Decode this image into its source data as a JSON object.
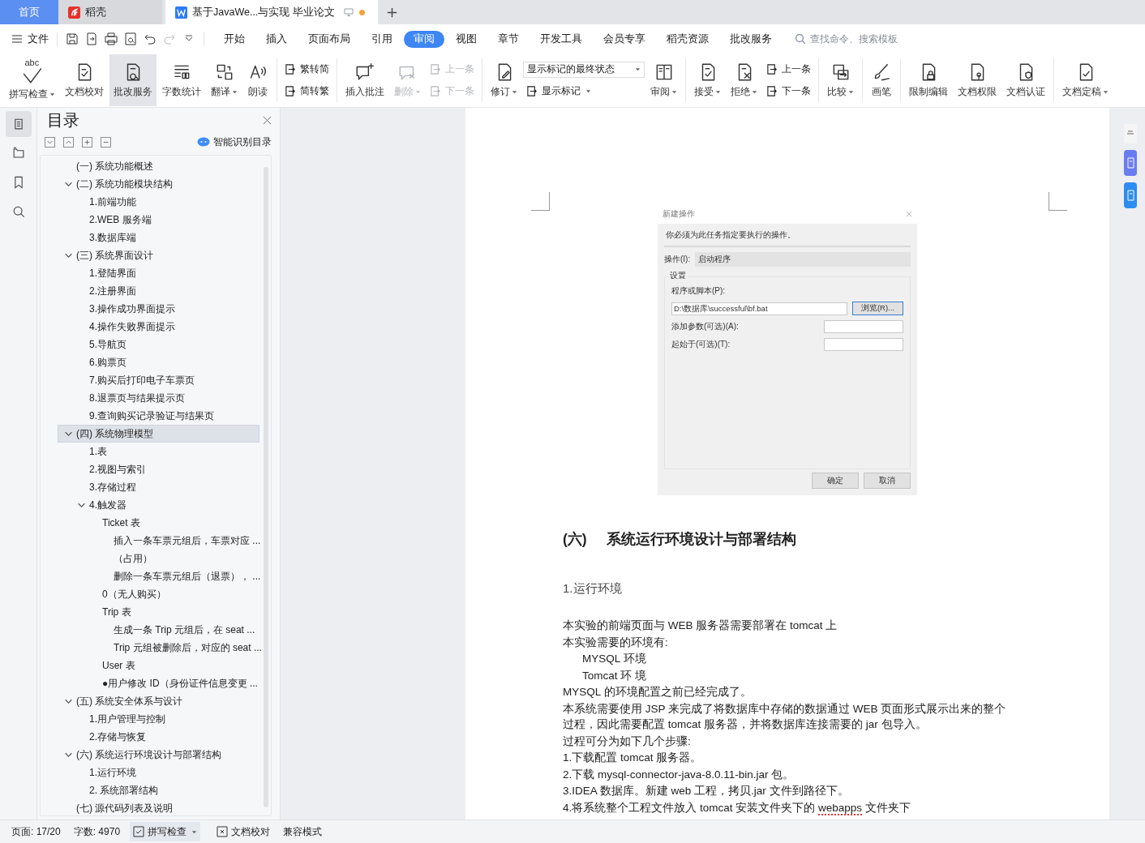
{
  "tabs": [
    {
      "kind": "home",
      "label": "首页",
      "selected": false
    },
    {
      "kind": "docer",
      "label": "稻壳",
      "selected": false
    },
    {
      "kind": "document",
      "label": "基于JavaWe...与实现 毕业论文",
      "selected": true,
      "unsaved": true
    }
  ],
  "menu": {
    "file": "文件",
    "tabs": [
      {
        "label": "开始",
        "selected": false
      },
      {
        "label": "插入",
        "selected": false
      },
      {
        "label": "页面布局",
        "selected": false
      },
      {
        "label": "引用",
        "selected": false
      },
      {
        "label": "审阅",
        "selected": true
      },
      {
        "label": "视图",
        "selected": false
      },
      {
        "label": "章节",
        "selected": false
      },
      {
        "label": "开发工具",
        "selected": false
      },
      {
        "label": "会员专享",
        "selected": false
      },
      {
        "label": "稻壳资源",
        "selected": false
      },
      {
        "label": "批改服务",
        "selected": false
      }
    ],
    "search": {
      "placeholder": "查找命令、搜索模板"
    }
  },
  "ribbon": {
    "groups": [
      {
        "items": [
          {
            "kind": "large",
            "label": "拼写检查",
            "icon_text": "abc",
            "dropdown": true,
            "disabled": false,
            "active": false
          },
          {
            "kind": "large",
            "label": "文档校对",
            "dropdown": false,
            "disabled": false,
            "active": false
          },
          {
            "kind": "large",
            "label": "批改服务",
            "dropdown": false,
            "disabled": false,
            "active": true
          },
          {
            "kind": "large",
            "label": "字数统计",
            "dropdown": false,
            "disabled": false,
            "active": false
          },
          {
            "kind": "large",
            "label": "翻译",
            "dropdown": true,
            "disabled": false,
            "active": false
          },
          {
            "kind": "large",
            "label": "朗读",
            "dropdown": false,
            "disabled": false,
            "active": false
          }
        ]
      },
      {
        "items": [
          {
            "kind": "stack",
            "items": [
              {
                "kind": "small",
                "label": "繁转简",
                "dropdown": false,
                "disabled": false
              },
              {
                "kind": "small",
                "label": "简转繁",
                "dropdown": false,
                "disabled": false
              }
            ]
          }
        ]
      },
      {
        "items": [
          {
            "kind": "large",
            "label": "插入批注",
            "dropdown": false,
            "disabled": false,
            "active": false
          },
          {
            "kind": "large",
            "label": "删除",
            "dropdown": true,
            "disabled": true,
            "active": false
          },
          {
            "kind": "stack",
            "items": [
              {
                "kind": "small",
                "label": "上一条",
                "dropdown": false,
                "disabled": true
              },
              {
                "kind": "small",
                "label": "下一条",
                "dropdown": false,
                "disabled": true
              }
            ]
          }
        ]
      },
      {
        "items": [
          {
            "kind": "large",
            "label": "修订",
            "dropdown": true,
            "disabled": false,
            "active": false
          },
          {
            "kind": "stack",
            "items": [
              {
                "kind": "select",
                "value": "显示标记的最终状态"
              },
              {
                "kind": "small",
                "label": "显示标记",
                "dropdown": true,
                "disabled": false
              }
            ]
          },
          {
            "kind": "large",
            "label": "审阅",
            "dropdown": true,
            "disabled": false,
            "active": false
          }
        ]
      },
      {
        "items": [
          {
            "kind": "large",
            "label": "接受",
            "dropdown": true,
            "disabled": false,
            "active": false
          },
          {
            "kind": "large",
            "label": "拒绝",
            "dropdown": true,
            "disabled": false,
            "active": false
          },
          {
            "kind": "stack",
            "items": [
              {
                "kind": "small",
                "label": "上一条",
                "dropdown": false,
                "disabled": false
              },
              {
                "kind": "small",
                "label": "下一条",
                "dropdown": false,
                "disabled": false
              }
            ]
          }
        ]
      },
      {
        "items": [
          {
            "kind": "large",
            "label": "比较",
            "dropdown": true,
            "disabled": false,
            "active": false
          }
        ]
      },
      {
        "items": [
          {
            "kind": "large",
            "label": "画笔",
            "dropdown": false,
            "disabled": false,
            "active": false
          }
        ]
      },
      {
        "items": [
          {
            "kind": "large",
            "label": "限制编辑",
            "dropdown": false,
            "disabled": false,
            "active": false
          },
          {
            "kind": "large",
            "label": "文档权限",
            "dropdown": false,
            "disabled": false,
            "active": false
          },
          {
            "kind": "large",
            "label": "文档认证",
            "dropdown": false,
            "disabled": false,
            "active": false
          }
        ]
      },
      {
        "items": [
          {
            "kind": "large",
            "label": "文档定稿",
            "dropdown": true,
            "disabled": false,
            "active": false
          }
        ]
      }
    ]
  },
  "nav_icons": [
    {
      "selected": true
    },
    {
      "selected": false
    },
    {
      "selected": false
    },
    {
      "selected": false
    }
  ],
  "toc": {
    "title": "目录",
    "smart_button": "智能识别目录",
    "items": [
      {
        "text": "(一) 系统功能概述",
        "selected": false
      },
      {
        "text": "(二) 系统功能模块结构",
        "selected": false,
        "expanded": true,
        "children": [
          {
            "text": "1.前端功能",
            "selected": false
          },
          {
            "text": "2.WEB 服务端",
            "selected": false
          },
          {
            "text": "3.数据库端",
            "selected": false
          }
        ]
      },
      {
        "text": "(三) 系统界面设计",
        "selected": false,
        "expanded": true,
        "children": [
          {
            "text": "1.登陆界面",
            "selected": false
          },
          {
            "text": "2.注册界面",
            "selected": false
          },
          {
            "text": "3.操作成功界面提示",
            "selected": false
          },
          {
            "text": "4.操作失败界面提示",
            "selected": false
          },
          {
            "text": "5.导航页",
            "selected": false
          },
          {
            "text": "6.购票页",
            "selected": false
          },
          {
            "text": "7.购买后打印电子车票页",
            "selected": false
          },
          {
            "text": "8.退票页与结果提示页",
            "selected": false
          },
          {
            "text": "9.查询购买记录验证与结果页",
            "selected": false
          }
        ]
      },
      {
        "text": "(四) 系统物理模型",
        "selected": true,
        "expanded": true,
        "children": [
          {
            "text": "1.表",
            "selected": false
          },
          {
            "text": "2.视图与索引",
            "selected": false
          },
          {
            "text": "3.存储过程",
            "selected": false
          },
          {
            "text": "4.触发器",
            "selected": false,
            "expanded": true,
            "children": [
              {
                "text": "Ticket 表",
                "selected": false,
                "children": [
                  {
                    "text": "插入一条车票元组后，车票对应 ...",
                    "selected": false
                  },
                  {
                    "text": "（占用）",
                    "selected": false
                  },
                  {
                    "text": "删除一条车票元组后（退票），  ...",
                    "selected": false
                  }
                ]
              },
              {
                "text": "0（无人购买）",
                "selected": false
              },
              {
                "text": "Trip 表",
                "selected": false,
                "children": [
                  {
                    "text": "生成一条 Trip 元组后，在 seat  ...",
                    "selected": false
                  },
                  {
                    "text": "Trip 元组被删除后，对应的 seat ...",
                    "selected": false
                  }
                ]
              },
              {
                "text": "User 表",
                "selected": false
              },
              {
                "text": "●用户修改 ID（身份证件信息变更 ...",
                "selected": false
              }
            ]
          }
        ]
      },
      {
        "text": "(五) 系统安全体系与设计",
        "selected": false,
        "expanded": true,
        "children": [
          {
            "text": "1.用户管理与控制",
            "selected": false
          },
          {
            "text": "2.存储与恢复",
            "selected": false
          }
        ]
      },
      {
        "text": "(六) 系统运行环境设计与部署结构",
        "selected": false,
        "expanded": true,
        "children": [
          {
            "text": "1.运行环境",
            "selected": false
          },
          {
            "text": "2. 系统部署结构",
            "selected": false
          }
        ]
      },
      {
        "text": "(七) 源代码列表及说明",
        "selected": false
      }
    ]
  },
  "document": {
    "screenshot": {
      "title": "新建操作",
      "instruction": "你必须为此任务指定要执行的操作。",
      "action_label": "操作(I):",
      "action_value": "启动程序",
      "group": "设置",
      "program_label": "程序或脚本(P):",
      "program_value": "D:\\数据库\\successful\\bf.bat",
      "browse": "浏览(R)...",
      "args_label": "添加参数(可选)(A):",
      "start_label": "起始于(可选)(T):",
      "ok": "确定",
      "cancel": "取消"
    },
    "heading": {
      "number": "(六)",
      "title": "系统运行环境设计与部署结构"
    },
    "subheading": "1.运行环境",
    "paragraphs": [
      {
        "kind": "plain",
        "text": "本实验的前端页面与 WEB 服务器需要部署在 tomcat 上"
      },
      {
        "kind": "plain",
        "text": "本实验需要的环境有:"
      },
      {
        "kind": "indent",
        "text": "MYSQL 环境"
      },
      {
        "kind": "indent",
        "text": "Tomcat 环 境"
      },
      {
        "kind": "plain",
        "text": "MYSQL 的环境配置之前已经完成了。"
      },
      {
        "kind": "plain",
        "text": "本系统需要使用 JSP 来完成了将数据库中存储的数据通过 WEB 页面形式展示出来的整个过程，因此需要配置 tomcat 服务器，并将数据库连接需要的 jar 包导入。"
      },
      {
        "kind": "plain",
        "text": "过程可分为如下几个步骤:"
      },
      {
        "kind": "plain",
        "text": "1.下载配置 tomcat 服务器。"
      },
      {
        "kind": "plain",
        "text": "2.下载 mysql-connector-java-8.0.11-bin.jar 包。"
      },
      {
        "kind": "plain",
        "text": "3.IDEA 数据库。新建 web 工程，拷贝.jar 文件到路径下。"
      },
      {
        "kind": "parts",
        "parts": [
          {
            "text": "4.将系统整个工程文件放入 tomcat 安装文件夹下的 ",
            "misspelled": false
          },
          {
            "text": "webapps",
            "misspelled": true
          },
          {
            "text": " 文件夹下",
            "misspelled": false
          }
        ]
      }
    ]
  },
  "status_bar": {
    "page": "页面: 17/20",
    "words": "字数: 4970",
    "spell_check": "拼写检查",
    "proofread": "文档校对",
    "mode": "兼容模式"
  }
}
